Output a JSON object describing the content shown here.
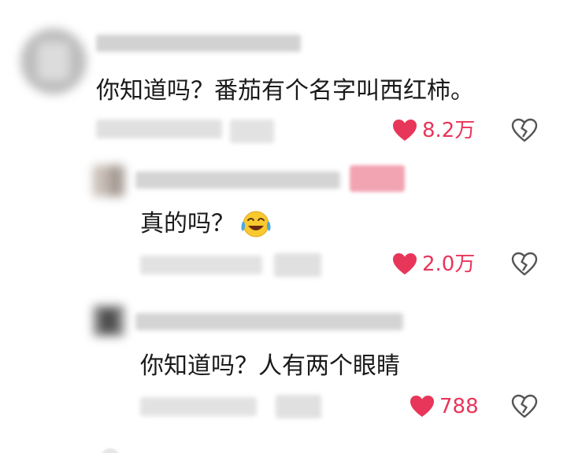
{
  "comments": [
    {
      "text": "你知道吗？番茄有个名字叫西红柿。",
      "likes": "8.2万",
      "emoji": ""
    },
    {
      "text": "真的吗？",
      "likes": "2.0万",
      "emoji": "crying-laughing-emoji"
    },
    {
      "text": "你知道吗？人有两个眼睛",
      "likes": "788",
      "emoji": ""
    }
  ],
  "icons": {
    "like": "heart-icon",
    "dislike": "broken-heart-icon"
  },
  "colors": {
    "like": "#e8365a",
    "text": "#1a1a1a",
    "dislike_stroke": "#555555",
    "tag": "#f2a4b3"
  }
}
